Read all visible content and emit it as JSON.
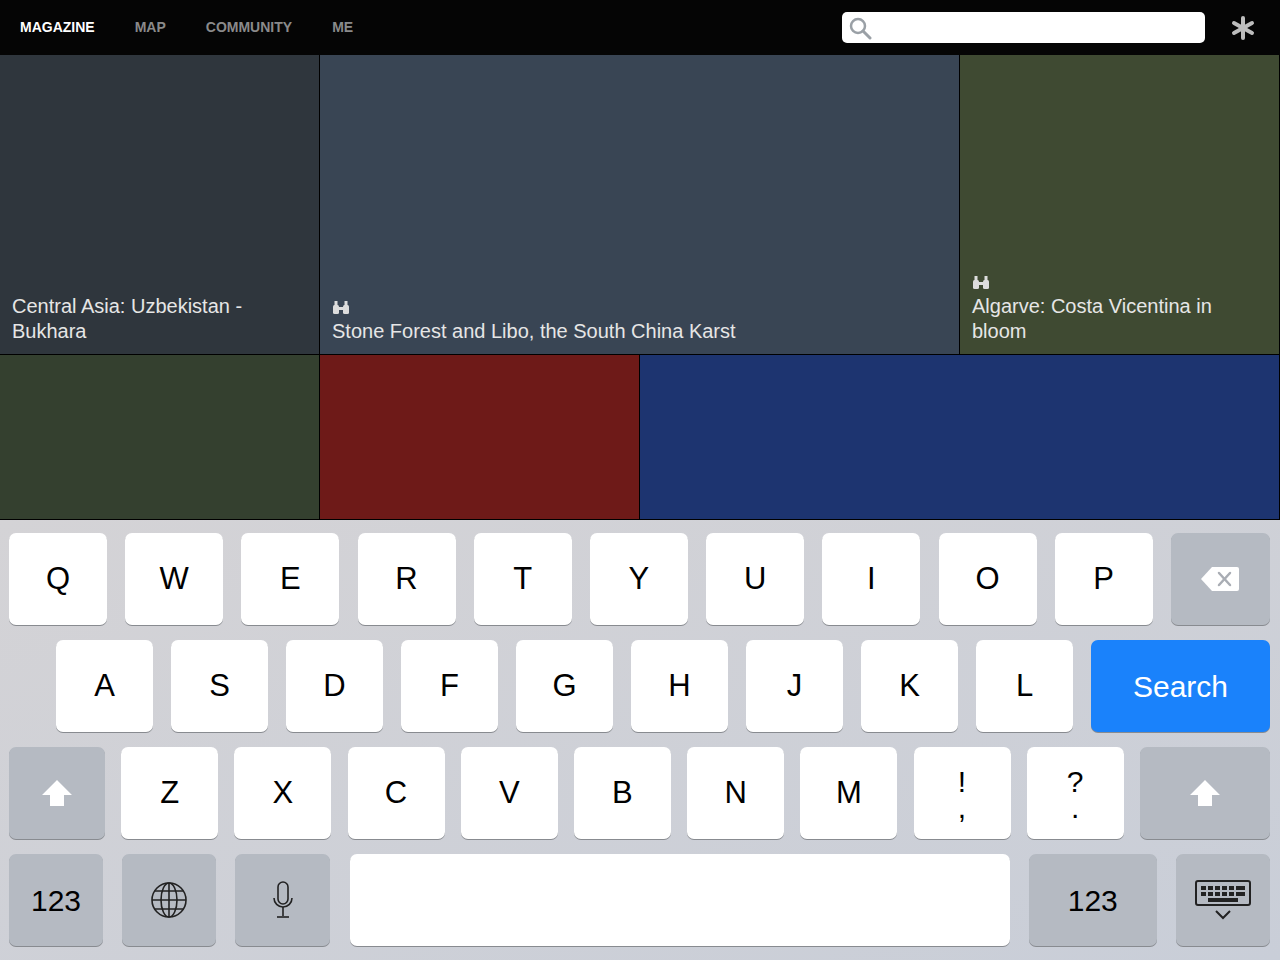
{
  "nav": {
    "tabs": [
      {
        "label": "MAGAZINE",
        "selected": true
      },
      {
        "label": "MAP",
        "selected": false
      },
      {
        "label": "COMMUNITY",
        "selected": false
      },
      {
        "label": "ME",
        "selected": false
      }
    ]
  },
  "tiles": [
    [
      {
        "caption": "Central Asia: Uzbekistan - Bukhara",
        "kind": "article"
      },
      {
        "caption": "Stone Forest and Libo, the South China Karst",
        "kind": "gallery"
      },
      {
        "caption": "Algarve: Costa Vicentina in bloom",
        "kind": "gallery"
      }
    ],
    [
      {
        "caption": "",
        "kind": "photo"
      },
      {
        "caption": "",
        "kind": "photo"
      },
      {
        "caption": "",
        "kind": "photo"
      }
    ]
  ],
  "keyboard": {
    "rows": [
      [
        {
          "label": "Q",
          "kind": "letter"
        },
        {
          "label": "W",
          "kind": "letter"
        },
        {
          "label": "E",
          "kind": "letter"
        },
        {
          "label": "R",
          "kind": "letter"
        },
        {
          "label": "T",
          "kind": "letter"
        },
        {
          "label": "Y",
          "kind": "letter"
        },
        {
          "label": "U",
          "kind": "letter"
        },
        {
          "label": "I",
          "kind": "letter"
        },
        {
          "label": "O",
          "kind": "letter"
        },
        {
          "label": "P",
          "kind": "letter"
        },
        {
          "label": "",
          "kind": "backspace"
        }
      ],
      [
        {
          "label": "A",
          "kind": "letter"
        },
        {
          "label": "S",
          "kind": "letter"
        },
        {
          "label": "D",
          "kind": "letter"
        },
        {
          "label": "F",
          "kind": "letter"
        },
        {
          "label": "G",
          "kind": "letter"
        },
        {
          "label": "H",
          "kind": "letter"
        },
        {
          "label": "J",
          "kind": "letter"
        },
        {
          "label": "K",
          "kind": "letter"
        },
        {
          "label": "L",
          "kind": "letter"
        },
        {
          "label": "Search",
          "kind": "search"
        }
      ],
      [
        {
          "label": "",
          "kind": "shift"
        },
        {
          "label": "Z",
          "kind": "letter"
        },
        {
          "label": "X",
          "kind": "letter"
        },
        {
          "label": "C",
          "kind": "letter"
        },
        {
          "label": "V",
          "kind": "letter"
        },
        {
          "label": "B",
          "kind": "letter"
        },
        {
          "label": "N",
          "kind": "letter"
        },
        {
          "label": "M",
          "kind": "letter"
        },
        {
          "label": "!",
          "sub": ",",
          "kind": "punct"
        },
        {
          "label": "?",
          "sub": ".",
          "kind": "punct"
        },
        {
          "label": "",
          "kind": "shift"
        }
      ],
      [
        {
          "label": "123",
          "kind": "numbers"
        },
        {
          "label": "",
          "kind": "globe"
        },
        {
          "label": "",
          "kind": "mic"
        },
        {
          "label": "",
          "kind": "space"
        },
        {
          "label": "123",
          "kind": "numbers"
        },
        {
          "label": "",
          "kind": "hide"
        }
      ]
    ]
  }
}
